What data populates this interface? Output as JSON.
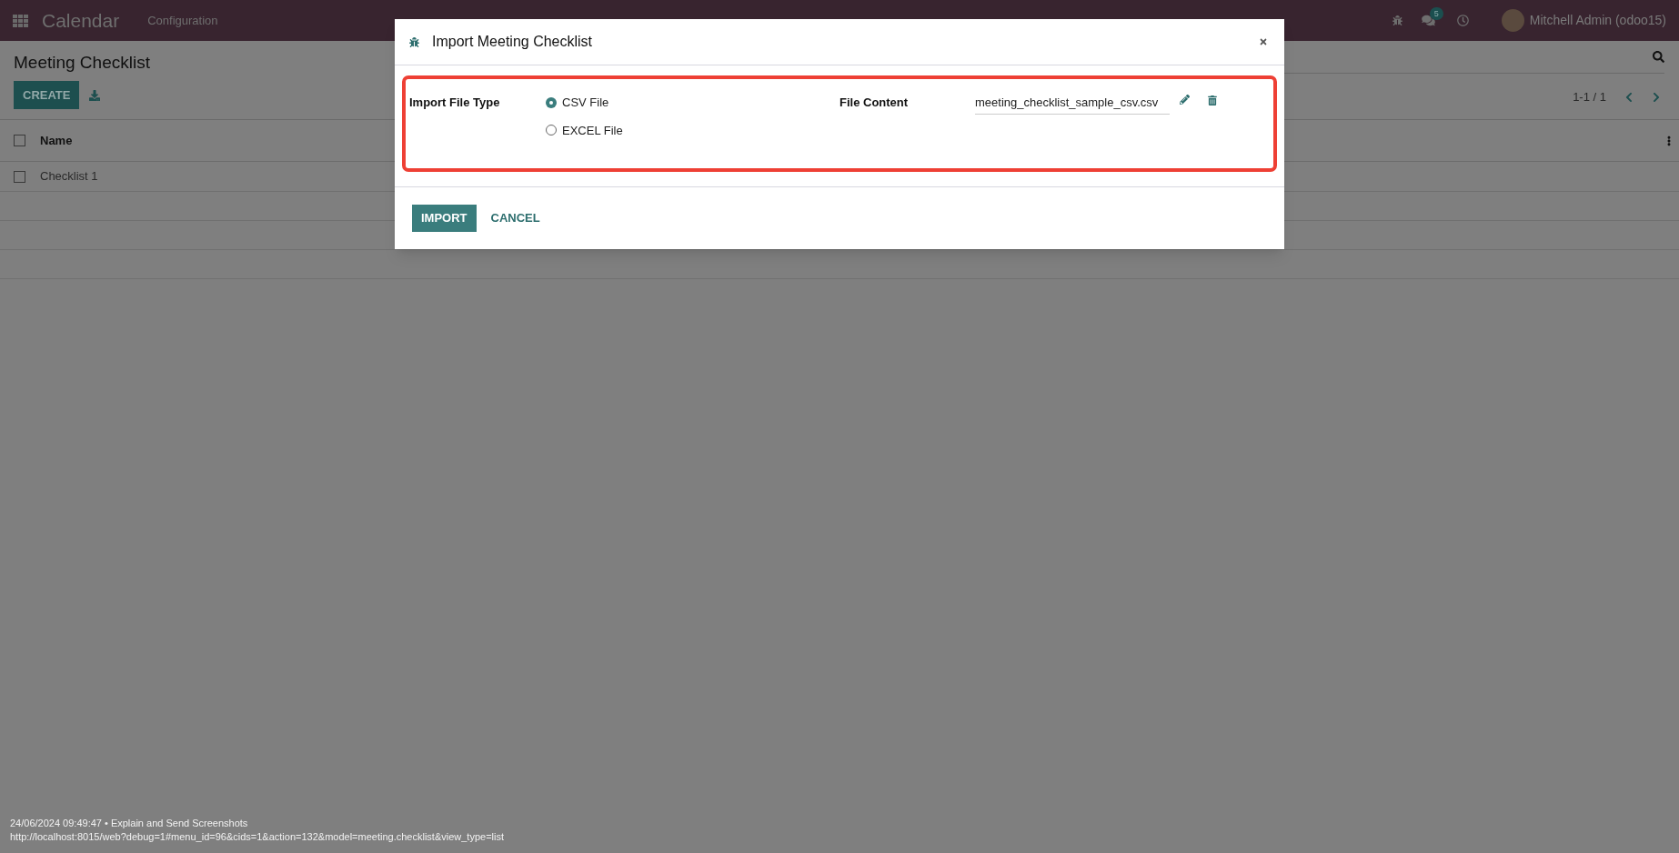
{
  "navbar": {
    "app_name": "Calendar",
    "menu": [
      "Configuration"
    ],
    "messages_badge": "5",
    "user_name": "Mitchell Admin (odoo15)"
  },
  "page": {
    "title": "Meeting Checklist",
    "create_button": "CREATE",
    "pager": "1-1 / 1"
  },
  "table": {
    "select_all_checked": false,
    "columns": [
      "Name"
    ],
    "rows": [
      {
        "name": "Checklist 1",
        "checked": false
      }
    ]
  },
  "dialog": {
    "title": "Import Meeting Checklist",
    "file_type_label": "Import File Type",
    "file_type_options": [
      {
        "label": "CSV File",
        "selected": true
      },
      {
        "label": "EXCEL File",
        "selected": false
      }
    ],
    "file_content_label": "File Content",
    "file_name": "meeting_checklist_sample_csv.csv",
    "import_button": "IMPORT",
    "cancel_button": "CANCEL"
  },
  "footer": {
    "timestamp_line": "24/06/2024 09:49:47 • Explain and Send Screenshots",
    "url": "http://localhost:8015/web?debug=1#menu_id=96&cids=1&action=132&model=meeting.checklist&view_type=list"
  }
}
